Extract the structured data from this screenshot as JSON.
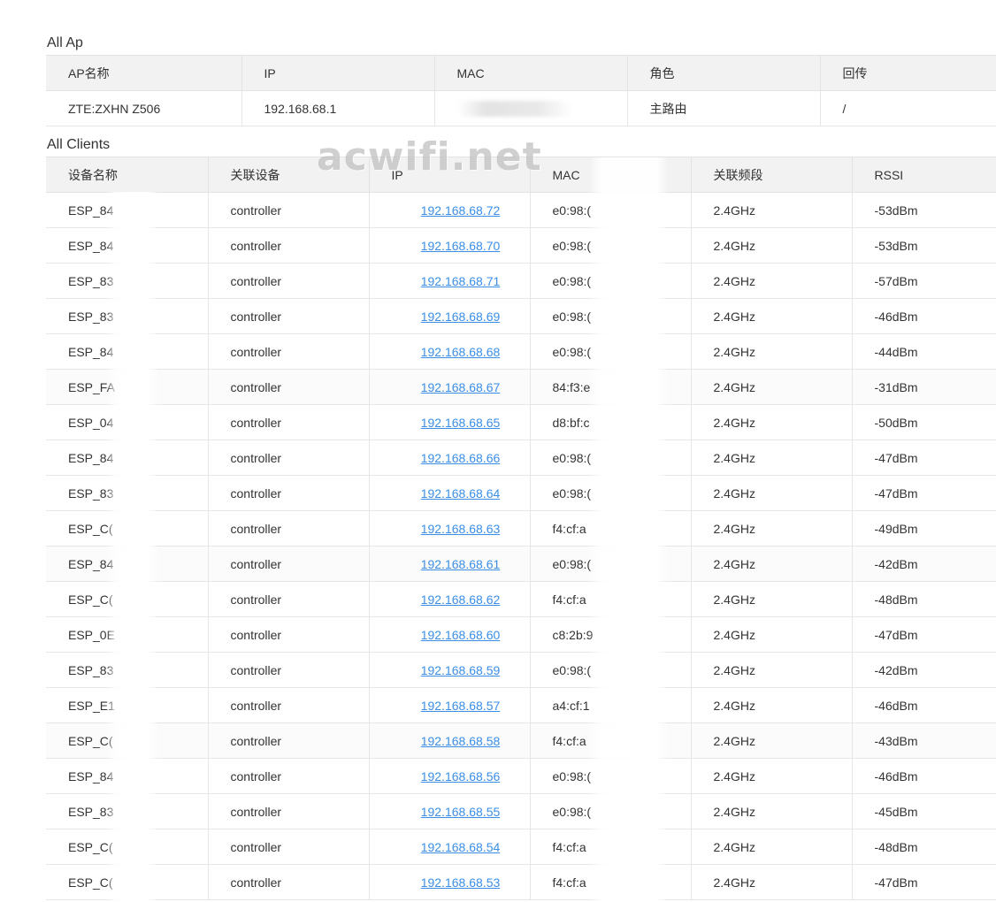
{
  "ap_section": {
    "title": "All Ap",
    "headers": [
      "AP名称",
      "IP",
      "MAC",
      "角色",
      "回传"
    ],
    "rows": [
      {
        "name": "ZTE:ZXHN Z506",
        "ip": "192.168.68.1",
        "mac": "",
        "role": "主路由",
        "backhaul": "/"
      }
    ]
  },
  "clients_section": {
    "title": "All Clients",
    "headers": [
      "设备名称",
      "关联设备",
      "IP",
      "MAC",
      "关联频段",
      "RSSI"
    ],
    "rows": [
      {
        "name": "ESP_84",
        "device": "controller",
        "ip": "192.168.68.72",
        "mac": "e0:98:(",
        "band": "2.4GHz",
        "rssi": "-53dBm"
      },
      {
        "name": "ESP_84",
        "device": "controller",
        "ip": "192.168.68.70",
        "mac": "e0:98:(",
        "band": "2.4GHz",
        "rssi": "-53dBm"
      },
      {
        "name": "ESP_83",
        "device": "controller",
        "ip": "192.168.68.71",
        "mac": "e0:98:(",
        "band": "2.4GHz",
        "rssi": "-57dBm"
      },
      {
        "name": "ESP_83",
        "device": "controller",
        "ip": "192.168.68.69",
        "mac": "e0:98:(",
        "band": "2.4GHz",
        "rssi": "-46dBm"
      },
      {
        "name": "ESP_84",
        "device": "controller",
        "ip": "192.168.68.68",
        "mac": "e0:98:(",
        "band": "2.4GHz",
        "rssi": "-44dBm"
      },
      {
        "name": "ESP_FA",
        "device": "controller",
        "ip": "192.168.68.67",
        "mac": "84:f3:e",
        "band": "2.4GHz",
        "rssi": "-31dBm"
      },
      {
        "name": "ESP_04",
        "device": "controller",
        "ip": "192.168.68.65",
        "mac": "d8:bf:c",
        "band": "2.4GHz",
        "rssi": "-50dBm"
      },
      {
        "name": "ESP_84",
        "device": "controller",
        "ip": "192.168.68.66",
        "mac": "e0:98:(",
        "band": "2.4GHz",
        "rssi": "-47dBm"
      },
      {
        "name": "ESP_83",
        "device": "controller",
        "ip": "192.168.68.64",
        "mac": "e0:98:(",
        "band": "2.4GHz",
        "rssi": "-47dBm"
      },
      {
        "name": "ESP_C(",
        "device": "controller",
        "ip": "192.168.68.63",
        "mac": "f4:cf:a",
        "band": "2.4GHz",
        "rssi": "-49dBm"
      },
      {
        "name": "ESP_84",
        "device": "controller",
        "ip": "192.168.68.61",
        "mac": "e0:98:(",
        "band": "2.4GHz",
        "rssi": "-42dBm"
      },
      {
        "name": "ESP_C(",
        "device": "controller",
        "ip": "192.168.68.62",
        "mac": "f4:cf:a",
        "band": "2.4GHz",
        "rssi": "-48dBm"
      },
      {
        "name": "ESP_0E",
        "device": "controller",
        "ip": "192.168.68.60",
        "mac": "c8:2b:9",
        "band": "2.4GHz",
        "rssi": "-47dBm"
      },
      {
        "name": "ESP_83",
        "device": "controller",
        "ip": "192.168.68.59",
        "mac": "e0:98:(",
        "band": "2.4GHz",
        "rssi": "-42dBm"
      },
      {
        "name": "ESP_E1",
        "device": "controller",
        "ip": "192.168.68.57",
        "mac": "a4:cf:1",
        "band": "2.4GHz",
        "rssi": "-46dBm"
      },
      {
        "name": "ESP_C(",
        "device": "controller",
        "ip": "192.168.68.58",
        "mac": "f4:cf:a",
        "band": "2.4GHz",
        "rssi": "-43dBm"
      },
      {
        "name": "ESP_84",
        "device": "controller",
        "ip": "192.168.68.56",
        "mac": "e0:98:(",
        "band": "2.4GHz",
        "rssi": "-46dBm"
      },
      {
        "name": "ESP_83",
        "device": "controller",
        "ip": "192.168.68.55",
        "mac": "e0:98:(",
        "band": "2.4GHz",
        "rssi": "-45dBm"
      },
      {
        "name": "ESP_C(",
        "device": "controller",
        "ip": "192.168.68.54",
        "mac": "f4:cf:a",
        "band": "2.4GHz",
        "rssi": "-48dBm"
      },
      {
        "name": "ESP_C(",
        "device": "controller",
        "ip": "192.168.68.53",
        "mac": "f4:cf:a",
        "band": "2.4GHz",
        "rssi": "-47dBm"
      }
    ]
  },
  "watermark": "acwifi.net",
  "colors": {
    "link": "#3a8ee6",
    "header_bg": "#f2f2f2",
    "border": "#e6e6e6"
  }
}
